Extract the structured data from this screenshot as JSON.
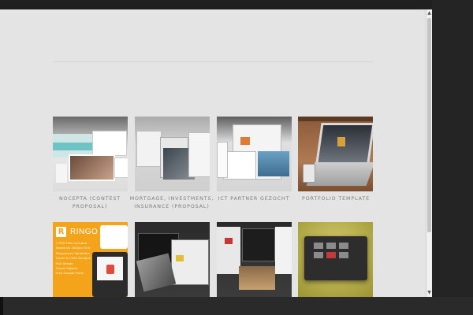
{
  "portfolio": {
    "items": [
      {
        "title": "NOCEPTA (CONTEST PROPOSAL)"
      },
      {
        "title": "MORTGAGE, INVESTMENTS, INSURANCE (PROPOSAL)"
      },
      {
        "title": "ICT PARTNER GEZOCHT"
      },
      {
        "title": "PORTFOLIO TEMPLATE"
      },
      {
        "title": "RINGO",
        "thumb_lines": [
          "2 PSD Files Included",
          "Based on 1000px Grid",
          "Responsive Variations",
          "Home & Cloth Designs",
          "Flat Design",
          "Smart Objects",
          "Free Google Fonts"
        ]
      },
      {
        "title": ""
      },
      {
        "title": ""
      },
      {
        "title": ""
      }
    ]
  },
  "colors": {
    "page_background": "#e4e4e4",
    "caption_text": "#7e7e7e",
    "ringo_orange": "#f3a41b",
    "accent_yellow": "#c9b84a"
  }
}
